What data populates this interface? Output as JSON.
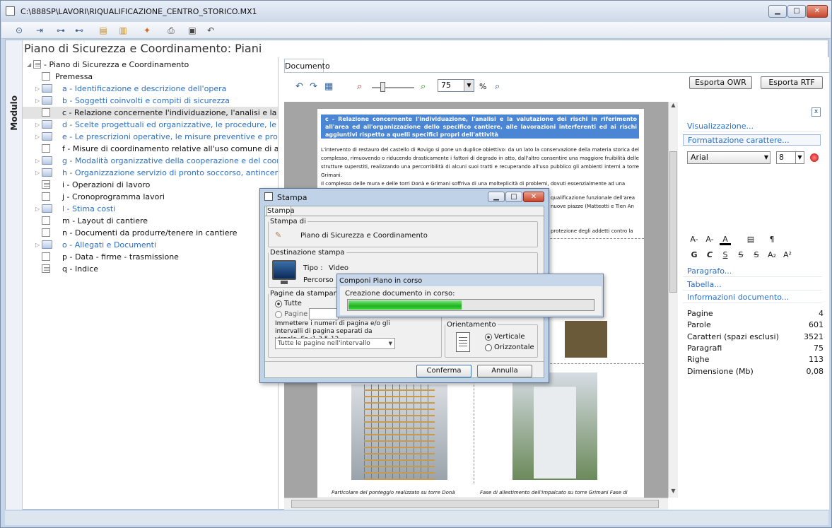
{
  "window": {
    "title": "C:\\888SP\\LAVORI\\RIQUALIFICAZIONE_CENTRO_STORICO.MX1",
    "min": "▁",
    "max": "□",
    "close": "✕"
  },
  "module_tab": "Modulo",
  "page_title": "Piano di Sicurezza e Coordinamento: Piani",
  "tree": {
    "root": "Piano di Sicurezza e Coordinamento",
    "items": [
      {
        "label": "Premessa",
        "style": "black",
        "icon": "pen"
      },
      {
        "label": "a - Identificazione e descrizione dell'opera",
        "style": "blue",
        "icon": "folder"
      },
      {
        "label": "b - Soggetti coinvolti e compiti di sicurezza",
        "style": "blue",
        "icon": "folder"
      },
      {
        "label": "c - Relazione concernente l'individuazione, l'analisi e la valutazione dei ris",
        "style": "black",
        "icon": "pen",
        "selected": true
      },
      {
        "label": "d - Scelte progettuali ed organizzative, le procedure, le misure preventiv",
        "style": "blue",
        "icon": "folder"
      },
      {
        "label": "e - Le prescrizioni operative, le misure preventive e protettive ed i dispo",
        "style": "blue",
        "icon": "folder"
      },
      {
        "label": "f - Misure di coordinamento relative all'uso comune di apprestamenti, att",
        "style": "black",
        "icon": "pen"
      },
      {
        "label": "g - Modalità organizzative della cooperazione e del coordinamento",
        "style": "blue",
        "icon": "folder"
      },
      {
        "label": "h - Organizzazione servizio di pronto soccorso, antincendio ed evacuazio",
        "style": "blue",
        "icon": "folder"
      },
      {
        "label": "i - Operazioni di lavoro",
        "style": "black",
        "icon": "doc"
      },
      {
        "label": "j - Cronoprogramma lavori",
        "style": "black",
        "icon": "pen"
      },
      {
        "label": "l - Stima costi",
        "style": "blue",
        "icon": "folder"
      },
      {
        "label": "m - Layout di cantiere",
        "style": "black",
        "icon": "pen"
      },
      {
        "label": "n - Documenti da produrre/tenere in cantiere",
        "style": "black",
        "icon": "pen"
      },
      {
        "label": "o - Allegati e Documenti",
        "style": "blue",
        "icon": "folder"
      },
      {
        "label": "p - Data - firme - trasmissione",
        "style": "black",
        "icon": "pen"
      },
      {
        "label": "q - Indice",
        "style": "black",
        "icon": "doc"
      }
    ]
  },
  "doc": {
    "tab": "Documento",
    "zoom": "75",
    "zoom_unit": "%",
    "export_owr": "Esporta OWR",
    "export_rtf": "Esporta RTF",
    "heading": "c - Relazione concernente l'individuazione, l'analisi e la valutazione dei rischi in riferimento all'area ed all'organizzazione dello specifico cantiere, alle lavorazioni interferenti ed ai rischi aggiuntivi rispetto a quelli specifici propri dell'attività",
    "para1": "L'intervento di restauro del castello di Rovigo si pone un duplice obiettivo: da un lato la conservazione della materia storica del complesso, rimuovendo o riducendo drasticamente i fattori di degrado in atto, dall'altro consentire una maggiore fruibilità delle strutture superstiti, realizzando una percorribilità di alcuni suoi tratti e recuperando all'uso pubblico gli ambienti interni a torre Grimani.",
    "para2": "Il complesso delle mura e delle torri Donà e Grimani soffriva di una molteplicità di problemi, dovuti essenzialmente ad una",
    "frag1": "qualificazione funzionale dell'area",
    "frag2": "nuove piazze (Matteotti e Tien An",
    "frag3": "protezione degli addetti contro la",
    "caption1": "Particolare del ponteggio realizzato su torre Donà",
    "caption2": "Fase di allestimento dell'impalcato su torre Grimani Fase di"
  },
  "right_panel": {
    "close": "x",
    "sections": {
      "view": "Visualizzazione...",
      "font": "Formattazione carattere...",
      "para": "Paragrafo...",
      "table": "Tabella...",
      "info": "Informazioni documento..."
    },
    "font_name": "Arial",
    "font_size": "8",
    "fmt_row1": [
      "A-",
      "A-",
      "A",
      "¶"
    ],
    "fmt_row2": [
      "G",
      "C",
      "S",
      "S",
      "S",
      "A₂",
      "A²"
    ],
    "stats": [
      {
        "label": "Pagine",
        "value": "4"
      },
      {
        "label": "Parole",
        "value": "601"
      },
      {
        "label": "Caratteri (spazi esclusi)",
        "value": "3521"
      },
      {
        "label": "Paragrafi",
        "value": "75"
      },
      {
        "label": "Righe",
        "value": "113"
      },
      {
        "label": "Dimensione (Mb)",
        "value": "0,08"
      }
    ]
  },
  "print_dialog": {
    "title": "Stampa",
    "tab": "Stampa",
    "group_stampa_di": "Stampa di",
    "stampa_di_value": "Piano di Sicurezza e Coordinamento",
    "group_dest": "Destinazione stampa",
    "tipo_label": "Tipo :",
    "tipo_value": "Video",
    "percorso_label": "Percorso",
    "group_pages": "Pagine da stampare",
    "opt_all": "Tutte",
    "opt_pages": "Pagine :",
    "hint": "Immettere i numeri di pagina e/o gli intervalli di pagina separati da virgole. Es.:1,3,5-12",
    "range_select": "Tutte le pagine nell'intervallo",
    "group_orient": "Orientamento",
    "opt_vertical": "Verticale",
    "opt_horizontal": "Orizzontale",
    "confirm": "Conferma",
    "cancel": "Annulla"
  },
  "progress_dialog": {
    "title": "Componi Piano in corso",
    "message": "Creazione documento in corso:",
    "progress": 0.46
  },
  "colors": {
    "accent": "#2a6fc4",
    "heading_bg": "#4a86d4",
    "progress": "#1fb41f"
  }
}
